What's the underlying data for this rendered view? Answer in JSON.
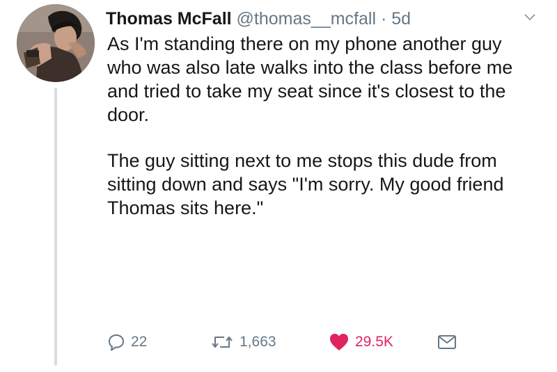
{
  "tweet": {
    "author_name": "Thomas McFall",
    "handle": "@thomas__mcfall",
    "separator": "·",
    "time": "5d",
    "paragraphs": [
      "As I'm standing there on my phone another guy who was also late walks into the class before me and tried to take my seat since it's closest to the door.",
      "The guy sitting next to me stops this dude from sitting down and says \"I'm sorry. My good friend Thomas sits here.\""
    ],
    "replies": "22",
    "retweets": "1,663",
    "likes": "29.5K"
  },
  "icons": {
    "reply": "reply-icon",
    "retweet": "retweet-icon",
    "like": "heart-icon",
    "message": "envelope-icon",
    "menu": "chevron-down-icon"
  },
  "colors": {
    "text": "#14171a",
    "muted": "#657786",
    "like": "#e0245e",
    "thread_line": "#d9dde1"
  }
}
